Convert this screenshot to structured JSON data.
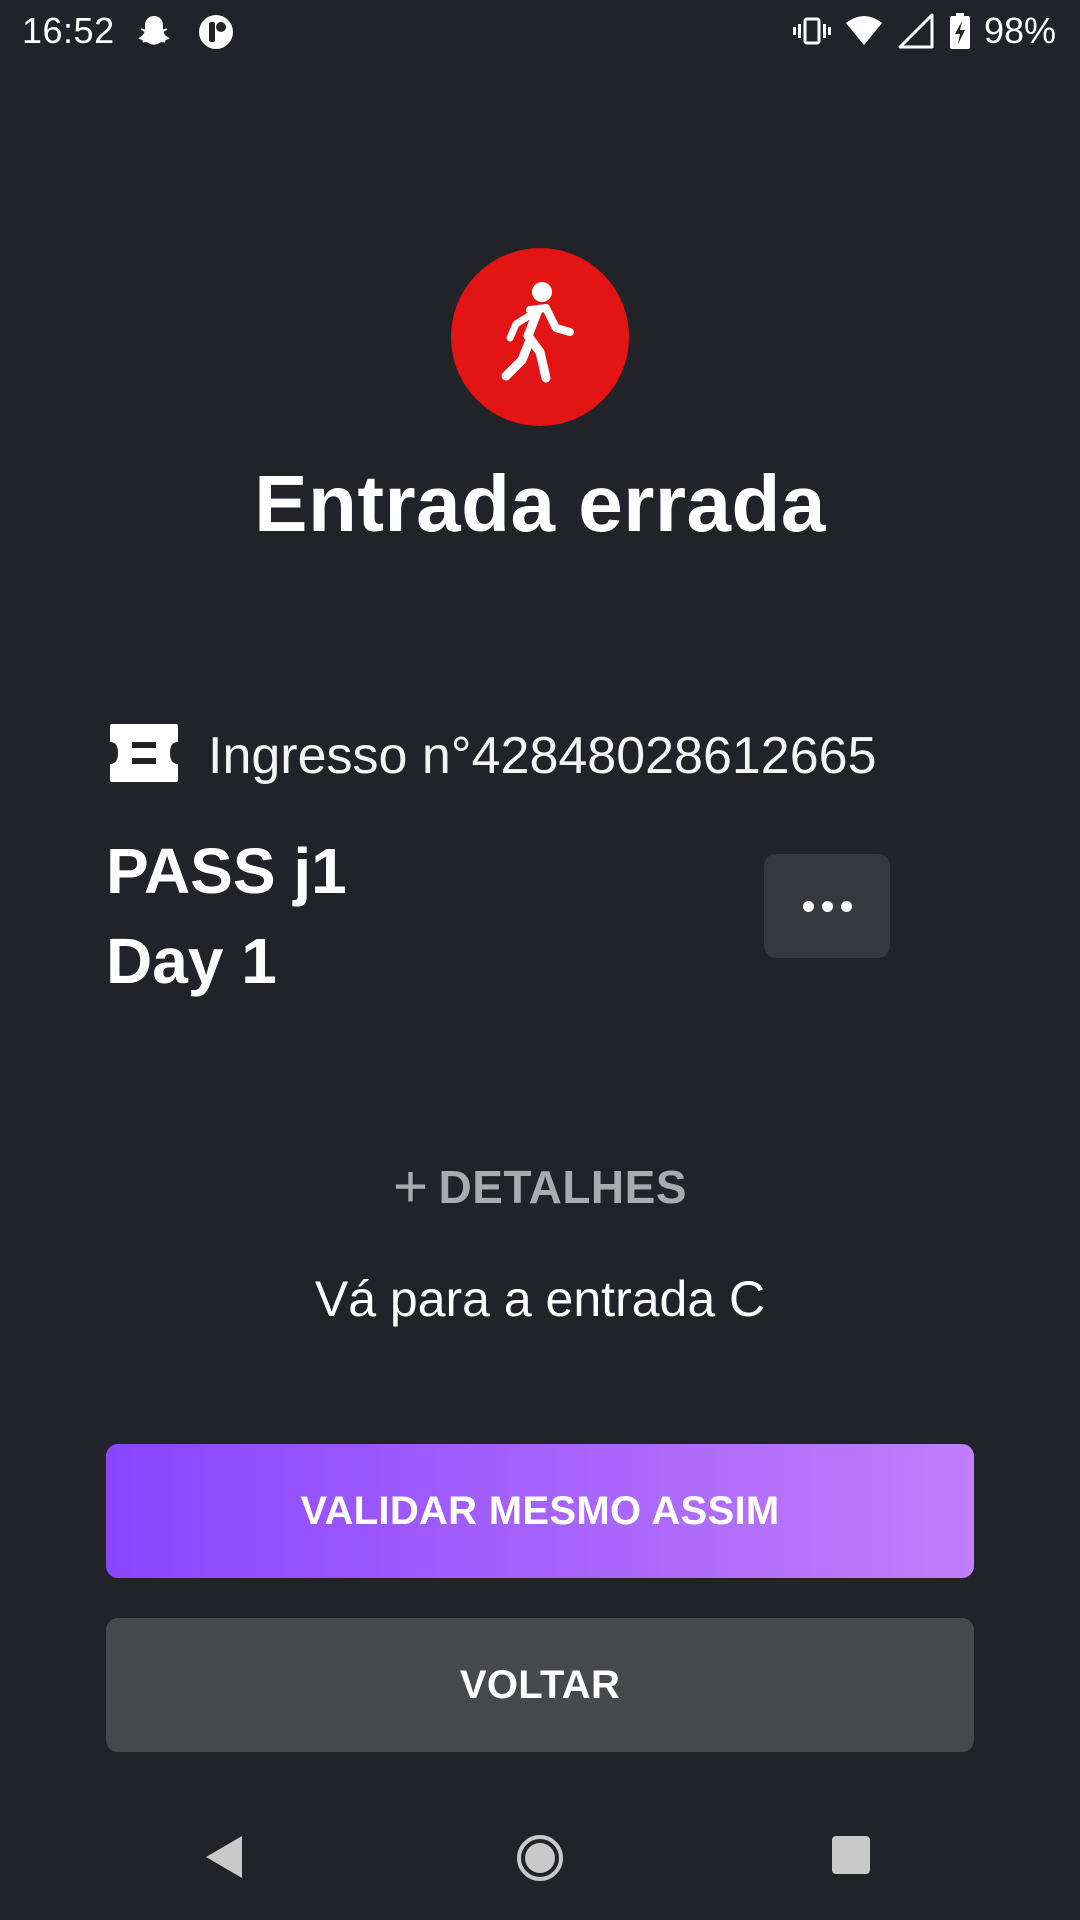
{
  "status_bar": {
    "time": "16:52",
    "battery_percent": "98%",
    "icons_left": [
      "snapchat-icon",
      "notification-app-icon"
    ],
    "icons_right": [
      "vibrate-icon",
      "wifi-icon",
      "cellular-signal-icon",
      "battery-charging-icon"
    ]
  },
  "header": {
    "icon": "walking-person-icon",
    "title": "Entrada errada",
    "alert_color": "#e31414"
  },
  "ticket": {
    "icon": "ticket-icon",
    "number": "Ingresso n°42848028612665",
    "name_line1": "PASS j1",
    "name_line2": "Day 1",
    "more_icon": "more-horizontal-icon"
  },
  "details": {
    "icon": "plus-icon",
    "label": "DETALHES"
  },
  "message": "Vá para a entrada C",
  "buttons": {
    "validate_label": "VALIDAR MESMO ASSIM",
    "back_label": "VOLTAR",
    "validate_gradient": [
      "#8a45ff",
      "#c17efb"
    ]
  },
  "navigation": {
    "icons": [
      "nav-back-icon",
      "nav-home-icon",
      "nav-recents-icon"
    ]
  }
}
